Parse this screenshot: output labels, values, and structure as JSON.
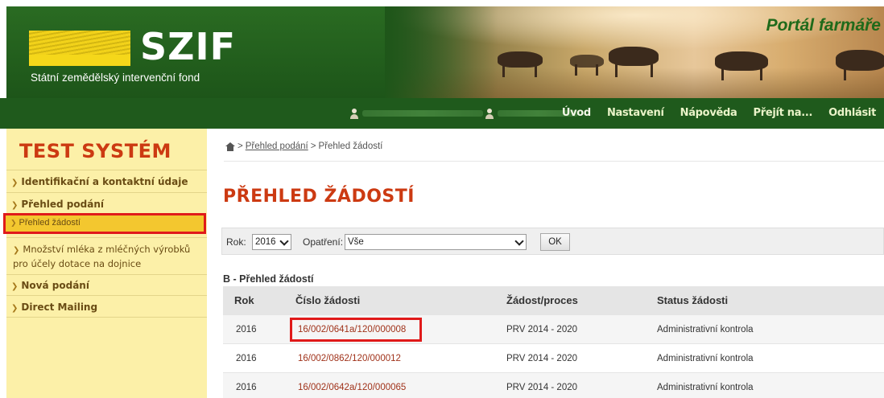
{
  "header": {
    "logo_text": "SZIF",
    "logo_subtitle": "Státní zemědělský intervenční fond",
    "portal_title": "Portál farmáře",
    "nav": [
      "Úvod",
      "Nastavení",
      "Nápověda",
      "Přejít na...",
      "Odhlásit"
    ]
  },
  "sidebar": {
    "title": "TEST SYSTÉM",
    "items": [
      {
        "label": "Identifikační a kontaktní údaje",
        "expanded": false
      },
      {
        "label": "Přehled podání",
        "expanded": true
      },
      {
        "label": "Přehled žádostí",
        "active": true
      },
      {
        "label": "Množství mléka z mléčných výrobků pro účely dotace na dojnice"
      },
      {
        "label": "Nová podání",
        "expanded": false
      },
      {
        "label": "Direct Mailing",
        "expanded": false
      }
    ]
  },
  "breadcrumb": {
    "link": "Přehled podání",
    "current": "Přehled žádostí"
  },
  "main": {
    "page_title": "PŘEHLED ŽÁDOSTÍ",
    "filter": {
      "rok_label": "Rok:",
      "rok_value": "2016",
      "opatreni_label": "Opatření:",
      "opatreni_value": "Vše",
      "ok_label": "OK"
    },
    "section_title": "B - Přehled žádostí",
    "table": {
      "headers": [
        "Rok",
        "Číslo žádosti",
        "Žádost/proces",
        "Status žádosti"
      ],
      "rows": [
        {
          "rok": "2016",
          "cislo": "16/002/0641a/120/000008",
          "proces": "PRV 2014 - 2020",
          "status": "Administrativní kontrola"
        },
        {
          "rok": "2016",
          "cislo": "16/002/0862/120/000012",
          "proces": "PRV 2014 - 2020",
          "status": "Administrativní kontrola"
        },
        {
          "rok": "2016",
          "cislo": "16/002/0642a/120/000065",
          "proces": "PRV 2014 - 2020",
          "status": "Administrativní kontrola"
        }
      ]
    }
  },
  "colors": {
    "header_green": "#1f5a1c",
    "sidebar_bg": "#fcf0a8",
    "title_orange": "#cc3a12",
    "highlight_red": "#e01a1a"
  }
}
